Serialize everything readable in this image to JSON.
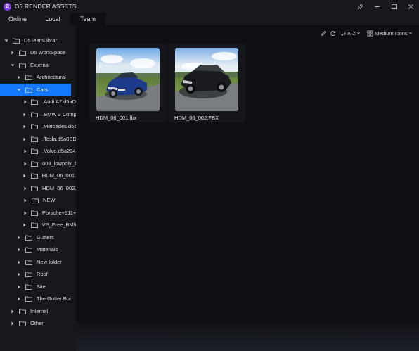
{
  "app": {
    "title": "D5 RENDER ASSETS",
    "logo_letter": "D"
  },
  "window_controls": [
    "pin-icon",
    "minimize-icon",
    "maximize-icon",
    "close-icon"
  ],
  "tabs": [
    {
      "label": "Online",
      "active": false
    },
    {
      "label": "Local",
      "active": false
    },
    {
      "label": "Team",
      "active": true
    }
  ],
  "toolbar": {
    "sort_label": "A-Z",
    "view_label": "Medium Icons",
    "icons": [
      "edit-icon",
      "refresh-icon",
      "sort-icon",
      "view-grid-icon"
    ]
  },
  "tree": [
    {
      "label": "D5TeamLibrar...",
      "expanded": true
    },
    {
      "label": "D5 WorkSpace",
      "expanded": false
    },
    {
      "label": "External",
      "expanded": true
    },
    {
      "label": "Architectural",
      "expanded": false
    },
    {
      "label": "Cars",
      "expanded": true,
      "selected": true
    },
    {
      "label": ".Audi A7.d5aD...",
      "expanded": false
    },
    {
      "label": ".BMW 3 Comp...",
      "expanded": false
    },
    {
      "label": ".Mercedes.d5a...",
      "expanded": false
    },
    {
      "label": ".Tesla.d5a0ED...",
      "expanded": false
    },
    {
      "label": ".Volvo.d5a234...",
      "expanded": false
    },
    {
      "label": "008_lowpoly_f...",
      "expanded": false
    },
    {
      "label": "HDM_06_001.f...",
      "expanded": false
    },
    {
      "label": "HDM_06_002....",
      "expanded": false
    },
    {
      "label": "NEW",
      "expanded": false
    },
    {
      "label": "Porsche+911+...",
      "expanded": false
    },
    {
      "label": "VP_Free_BMW...",
      "expanded": false
    },
    {
      "label": "Gutters",
      "expanded": false
    },
    {
      "label": "Materials",
      "expanded": false
    },
    {
      "label": "New folder",
      "expanded": false
    },
    {
      "label": "Roof",
      "expanded": false
    },
    {
      "label": "Site",
      "expanded": false
    },
    {
      "label": "The Gutter Boi",
      "expanded": false
    },
    {
      "label": "Internal",
      "expanded": false
    },
    {
      "label": "Other",
      "expanded": false
    }
  ],
  "assets": [
    {
      "name": "HDM_06_001.fbx",
      "car_color": "#1e3a8a"
    },
    {
      "name": "HDM_06_002.FBX",
      "car_color": "#1a1b1e"
    }
  ],
  "colors": {
    "accent": "#1478ff",
    "sidebar_bg": "#16181d",
    "content_bg": "#0d0f13",
    "logo": "#7b3fe4"
  }
}
